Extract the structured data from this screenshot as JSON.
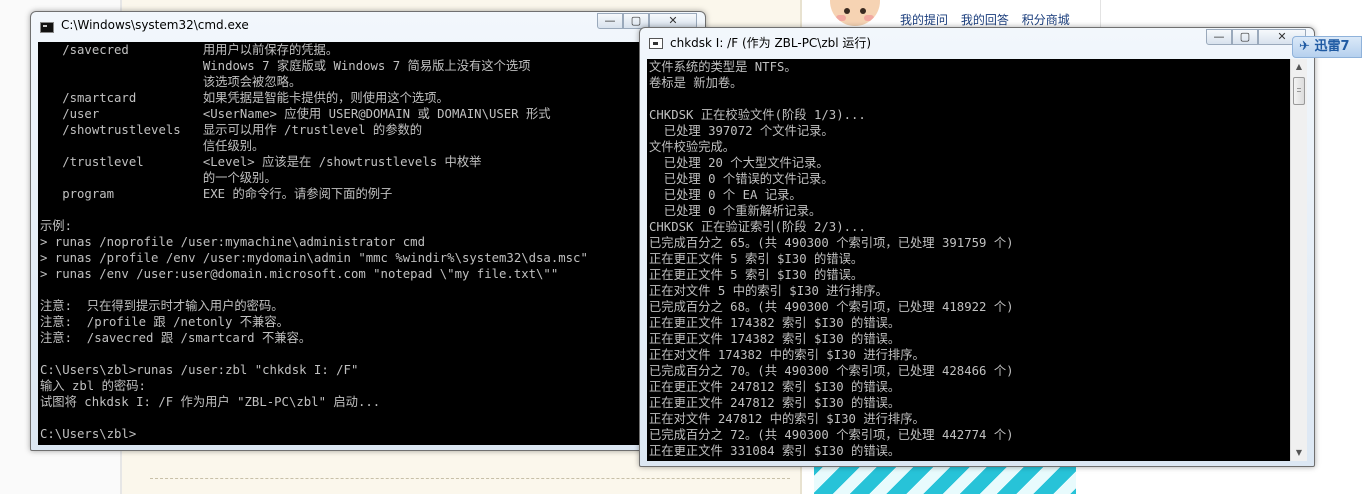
{
  "background_page": {
    "links": [
      "我的提问",
      "我的回答",
      "积分商城"
    ],
    "xunlei_badge": "迅雷7"
  },
  "cmd_window": {
    "title": "C:\\Windows\\system32\\cmd.exe",
    "lines": [
      "   /savecred          用用户以前保存的凭据。",
      "                      Windows 7 家庭版或 Windows 7 简易版上没有这个选项",
      "                      该选项会被忽略。",
      "   /smartcard         如果凭据是智能卡提供的，则使用这个选项。",
      "   /user              <UserName> 应使用 USER@DOMAIN 或 DOMAIN\\USER 形式",
      "   /showtrustlevels   显示可以用作 /trustlevel 的参数的",
      "                      信任级别。",
      "   /trustlevel        <Level> 应该是在 /showtrustlevels 中枚举",
      "                      的一个级别。",
      "   program            EXE 的命令行。请参阅下面的例子",
      "",
      "示例:",
      "> runas /noprofile /user:mymachine\\administrator cmd",
      "> runas /profile /env /user:mydomain\\admin \"mmc %windir%\\system32\\dsa.msc\"",
      "> runas /env /user:user@domain.microsoft.com \"notepad \\\"my file.txt\\\"\"",
      "",
      "注意:  只在得到提示时才输入用户的密码。",
      "注意:  /profile 跟 /netonly 不兼容。",
      "注意:  /savecred 跟 /smartcard 不兼容。",
      "",
      "C:\\Users\\zbl>runas /user:zbl \"chkdsk I: /F\"",
      "输入 zbl 的密码:",
      "试图将 chkdsk I: /F 作为用户 \"ZBL-PC\\zbl\" 启动...",
      "",
      "C:\\Users\\zbl>"
    ]
  },
  "chkdsk_window": {
    "title": "chkdsk I: /F (作为 ZBL-PC\\zbl 运行)",
    "lines": [
      "文件系统的类型是 NTFS。",
      "卷标是 新加卷。",
      "",
      "CHKDSK 正在校验文件(阶段 1/3)...",
      "  已处理 397072 个文件记录。",
      "文件校验完成。",
      "  已处理 20 个大型文件记录。",
      "  已处理 0 个错误的文件记录。",
      "  已处理 0 个 EA 记录。",
      "  已处理 0 个重新解析记录。",
      "CHKDSK 正在验证索引(阶段 2/3)...",
      "已完成百分之 65。(共 490300 个索引项，已处理 391759 个)",
      "正在更正文件 5 索引 $I30 的错误。",
      "正在更正文件 5 索引 $I30 的错误。",
      "正在对文件 5 中的索引 $I30 进行排序。",
      "已完成百分之 68。(共 490300 个索引项，已处理 418922 个)",
      "正在更正文件 174382 索引 $I30 的错误。",
      "正在更正文件 174382 索引 $I30 的错误。",
      "正在对文件 174382 中的索引 $I30 进行排序。",
      "已完成百分之 70。(共 490300 个索引项，已处理 428466 个)",
      "正在更正文件 247812 索引 $I30 的错误。",
      "正在更正文件 247812 索引 $I30 的错误。",
      "正在对文件 247812 中的索引 $I30 进行排序。",
      "已完成百分之 72。(共 490300 个索引项，已处理 442774 个)",
      "正在更正文件 331084 索引 $I30 的错误。"
    ]
  },
  "window_controls": {
    "minimize": "—",
    "maximize": "▢",
    "close": "✕"
  },
  "colors": {
    "console_bg": "#000000",
    "console_text": "#c0c0c0",
    "titlebar": "#dce7f3"
  }
}
